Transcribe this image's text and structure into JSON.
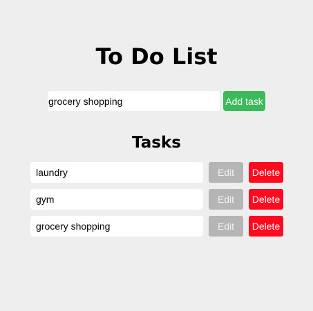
{
  "header": {
    "title": "To Do List"
  },
  "new_task": {
    "value": "grocery shopping",
    "add_label": "Add task"
  },
  "tasks_section": {
    "heading": "Tasks",
    "tasks": [
      {
        "text": "laundry",
        "edit_label": "Edit",
        "delete_label": "Delete"
      },
      {
        "text": "gym",
        "edit_label": "Edit",
        "delete_label": "Delete"
      },
      {
        "text": "grocery shopping",
        "edit_label": "Edit",
        "delete_label": "Delete"
      }
    ]
  },
  "colors": {
    "background": "#eeeeee",
    "add_button": "#3cba5a",
    "edit_button": "#b5b5b5",
    "delete_button": "#ff0a1f"
  }
}
